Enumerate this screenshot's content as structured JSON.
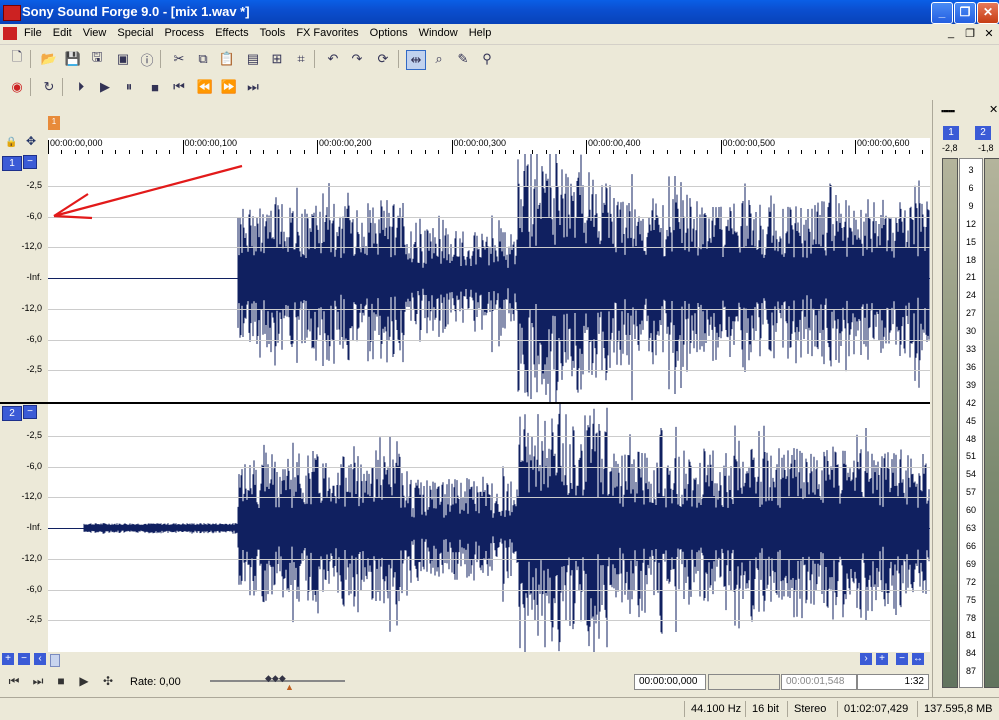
{
  "window": {
    "title": "Sony Sound Forge 9.0 - [mix 1.wav *]",
    "min_label": "_",
    "max_label": "❐",
    "close_label": "✕"
  },
  "menu": {
    "items": [
      {
        "label": "File"
      },
      {
        "label": "Edit"
      },
      {
        "label": "View"
      },
      {
        "label": "Special"
      },
      {
        "label": "Process"
      },
      {
        "label": "Effects"
      },
      {
        "label": "Tools"
      },
      {
        "label": "FX Favorites"
      },
      {
        "label": "Options"
      },
      {
        "label": "Window"
      },
      {
        "label": "Help"
      }
    ],
    "mdi_min": "_",
    "mdi_restore": "❐",
    "mdi_close": "✕"
  },
  "toolbar": {
    "buttons": [
      "new-icon",
      "open-icon",
      "save-icon",
      "save-as-icon",
      "render-icon",
      "properties-icon",
      "cut-icon",
      "copy-icon",
      "paste-icon",
      "paste-special-icon",
      "mix-icon",
      "crop-icon",
      "undo-icon",
      "redo-icon",
      "repeat-icon",
      "edit-tool-icon",
      "magnify-tool-icon",
      "pencil-tool-icon",
      "event-tool-icon"
    ]
  },
  "transport_top": [
    "record-icon",
    "loop-icon",
    "play-all-icon",
    "play-icon",
    "pause-icon",
    "stop-icon",
    "go-start-icon",
    "rewind-icon",
    "forward-icon",
    "go-end-icon"
  ],
  "ruler": {
    "marker_label": "1",
    "labels": [
      "00:00:00,000",
      "00:00:00,100",
      "00:00:00,200",
      "00:00:00,300",
      "00:00:00,400",
      "00:00:00,500",
      "00:00:00,600"
    ]
  },
  "channels": [
    {
      "num": "1",
      "min": "−",
      "db_labels": [
        "-2,5",
        "-6,0",
        "-12,0",
        "-Inf.",
        "-12,0",
        "-6,0",
        "-2,5"
      ]
    },
    {
      "num": "2",
      "min": "−",
      "db_labels": [
        "-2,5",
        "-6,0",
        "-12,0",
        "-Inf.",
        "-12,0",
        "-6,0",
        "-2,5"
      ]
    }
  ],
  "transport": {
    "rate_label": "Rate: 0,00",
    "time_start": "00:00:00,000",
    "time_end": "00:00:01,548",
    "zoom": "1:32"
  },
  "status": {
    "sample_rate": "44.100 Hz",
    "bit_depth": "16 bit",
    "channels": "Stereo",
    "length": "01:02:07,429",
    "free_space": "137.595,8 MB"
  },
  "meter": {
    "ch1": "1",
    "ch2": "2",
    "peak1": "-2,8",
    "peak2": "-1,8",
    "scale": [
      "3",
      "6",
      "9",
      "12",
      "15",
      "18",
      "21",
      "24",
      "27",
      "30",
      "33",
      "36",
      "39",
      "42",
      "45",
      "48",
      "51",
      "54",
      "57",
      "60",
      "63",
      "66",
      "69",
      "72",
      "75",
      "78",
      "81",
      "84",
      "87"
    ],
    "close": "✕",
    "grip": "▪▪▪▪▪▪"
  },
  "colors": {
    "waveform": "#102060",
    "annotation_arrow": "#e21a1a",
    "channel_badge": "#3b5bd6"
  }
}
